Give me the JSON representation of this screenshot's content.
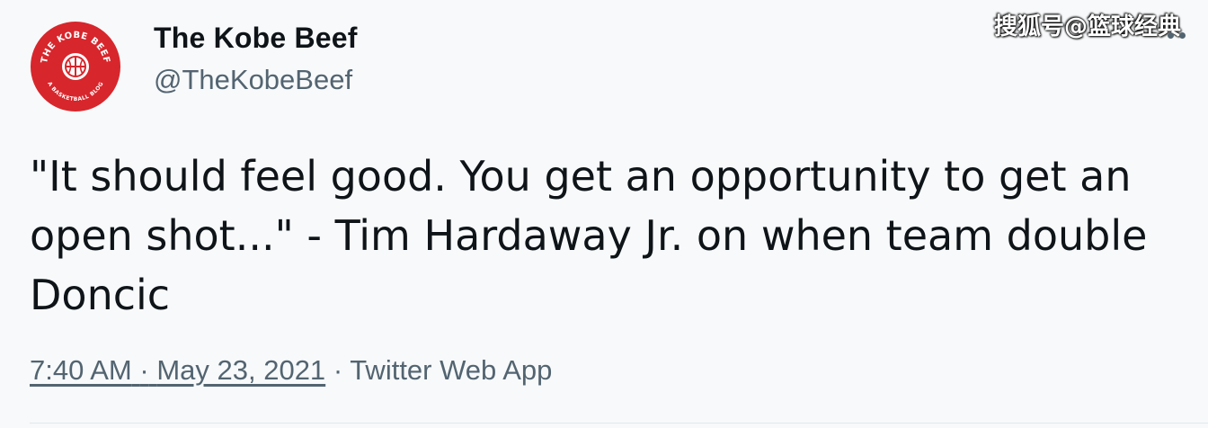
{
  "author": {
    "display_name": "The Kobe Beef",
    "handle": "@TheKobeBeef",
    "avatar": {
      "icon": "basketball-icon",
      "ring_text_top": "THE KOBE BEEF",
      "ring_text_bottom": "A BASKETBALL BLOG",
      "color": "#d7262c"
    }
  },
  "tweet": {
    "text": "\"It should feel good. You get an opportunity to get an open shot...\" - Tim Hardaway Jr. on when team double Doncic",
    "time": "7:40 AM",
    "separator": "·",
    "date": "May 23, 2021",
    "source": "Twitter Web App"
  },
  "watermark": "搜狐号@篮球经典",
  "menu": {
    "icon": "more-options-icon"
  },
  "colors": {
    "background": "#f7f9fa",
    "text_primary": "#0f1419",
    "text_secondary": "#536471",
    "brand_red": "#d7262c"
  }
}
